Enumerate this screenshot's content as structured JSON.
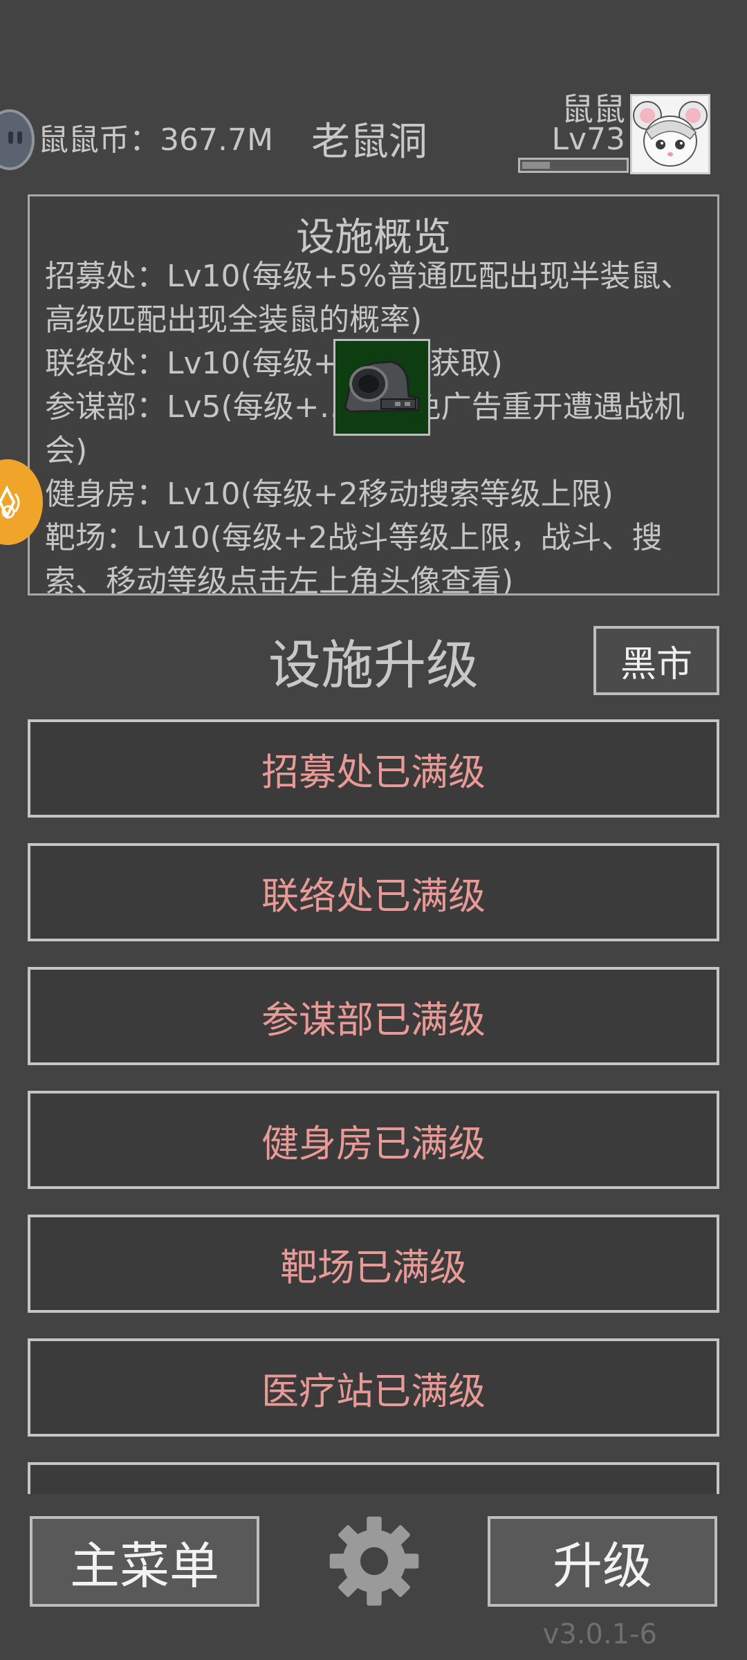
{
  "header": {
    "coin_icon": "rat-coin-icon",
    "coin_text": "鼠鼠币：367.7M",
    "area_title": "老鼠洞",
    "player": {
      "name": "鼠鼠",
      "level": "Lv73",
      "xp_progress": 0.3,
      "avatar_icon": "white-mouse-avatar"
    }
  },
  "overview": {
    "title": "设施概览",
    "lines": [
      "招募处：Lv10(每级+5%普通匹配出现半装鼠、高级匹配出现全装鼠的概率)",
      "联络处：Lv10(每级+…经验获取)",
      "参谋部：Lv5(每级+…局内免广告重开遭遇战机会)",
      "健身房：Lv10(每级+2移动搜索等级上限)",
      "靶场：Lv10(每级+2战斗等级上限，战斗、搜索、移动等级点击左上角头像查看)"
    ]
  },
  "floating_item_icon": "red-dot-scope-icon",
  "side_badge_icon": "orange-event-icon",
  "upgrade_section": {
    "title": "设施升级",
    "black_market_label": "黑市",
    "items": [
      "招募处已满级",
      "联络处已满级",
      "参谋部已满级",
      "健身房已满级",
      "靶场已满级",
      "医疗站已满级",
      ""
    ]
  },
  "bottom": {
    "main_menu_label": "主菜单",
    "settings_icon": "gear-icon",
    "upgrade_label": "升级",
    "version": "v3.0.1-6"
  },
  "colors": {
    "background": "#434343",
    "maxed_text": "#e89a96",
    "scope_bg": "#0e3d12",
    "badge": "#f0a52a"
  }
}
